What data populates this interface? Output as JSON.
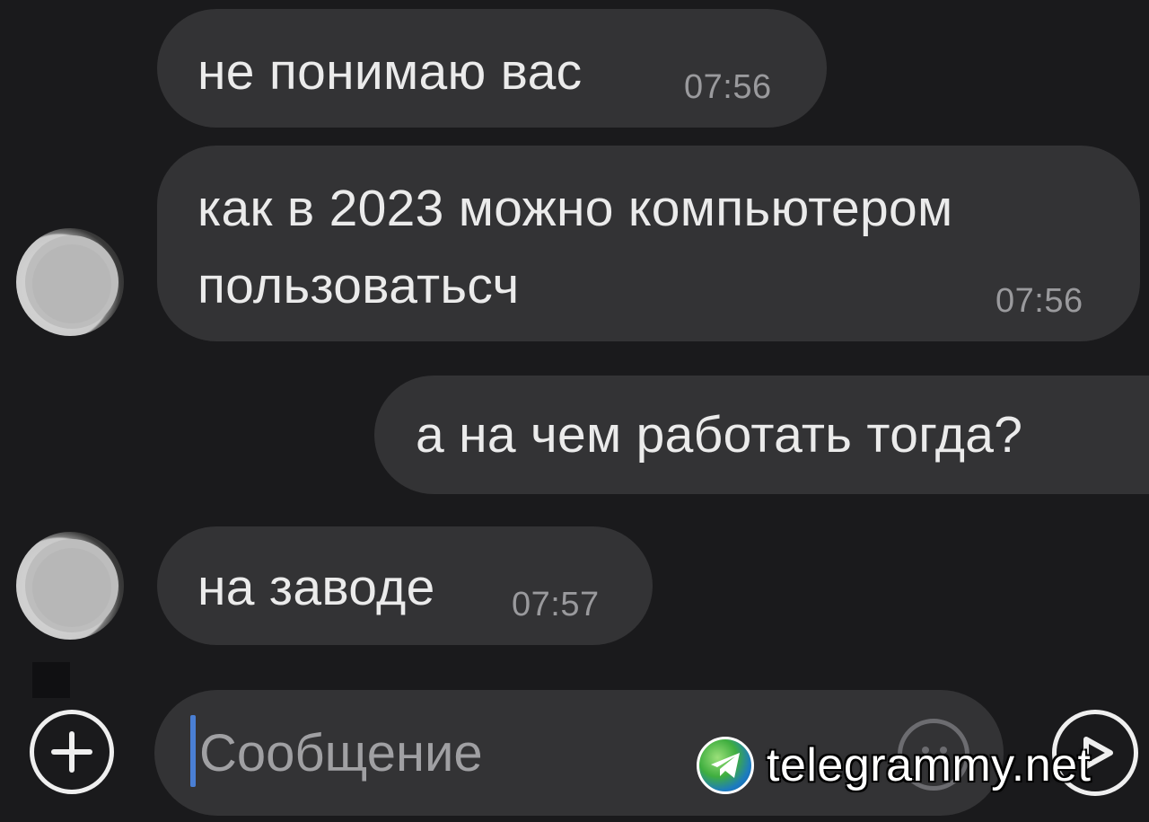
{
  "messages": [
    {
      "text": "не понимаю вас",
      "time": "07:56",
      "direction": "incoming"
    },
    {
      "lines": [
        "как в 2023 можно компьютером",
        "пользоватьсч"
      ],
      "time": "07:56",
      "direction": "incoming"
    },
    {
      "text": "а на чем работать тогда?",
      "direction": "outgoing"
    },
    {
      "text": "на заводе",
      "time": "07:57",
      "direction": "incoming"
    }
  ],
  "composer": {
    "placeholder": "Сообщение",
    "icons": [
      "plus-circle-icon",
      "emoji-icon",
      "send-icon"
    ]
  },
  "watermark": {
    "text": "telegrammy.net",
    "icon": "telegram-globe-icon"
  },
  "colors": {
    "background": "#1a1a1c",
    "bubble": "#333335",
    "text": "#ebebeb",
    "time": "#9a9a9d",
    "caret": "#4a7fd4"
  }
}
